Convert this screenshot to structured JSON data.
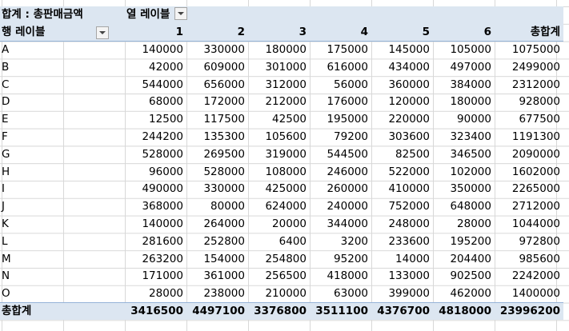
{
  "pivot": {
    "value_header": "합계 : 총판매금액",
    "col_label_header": "열 레이블",
    "row_label_header": "행 레이블",
    "grand_total_label": "총합계",
    "columns": [
      "1",
      "2",
      "3",
      "4",
      "5",
      "6"
    ],
    "rows": [
      {
        "label": "A",
        "values": [
          "140000",
          "330000",
          "180000",
          "175000",
          "145000",
          "105000"
        ],
        "total": "1075000"
      },
      {
        "label": "B",
        "values": [
          "42000",
          "609000",
          "301000",
          "616000",
          "434000",
          "497000"
        ],
        "total": "2499000"
      },
      {
        "label": "C",
        "values": [
          "544000",
          "656000",
          "312000",
          "56000",
          "360000",
          "384000"
        ],
        "total": "2312000"
      },
      {
        "label": "D",
        "values": [
          "68000",
          "172000",
          "212000",
          "176000",
          "120000",
          "180000"
        ],
        "total": "928000"
      },
      {
        "label": "E",
        "values": [
          "12500",
          "117500",
          "42500",
          "195000",
          "220000",
          "90000"
        ],
        "total": "677500"
      },
      {
        "label": "F",
        "values": [
          "244200",
          "135300",
          "105600",
          "79200",
          "303600",
          "323400"
        ],
        "total": "1191300"
      },
      {
        "label": "G",
        "values": [
          "528000",
          "269500",
          "319000",
          "544500",
          "82500",
          "346500"
        ],
        "total": "2090000"
      },
      {
        "label": "H",
        "values": [
          "96000",
          "528000",
          "108000",
          "246000",
          "522000",
          "102000"
        ],
        "total": "1602000"
      },
      {
        "label": "I",
        "values": [
          "490000",
          "330000",
          "425000",
          "260000",
          "410000",
          "350000"
        ],
        "total": "2265000"
      },
      {
        "label": "J",
        "values": [
          "368000",
          "80000",
          "624000",
          "240000",
          "752000",
          "648000"
        ],
        "total": "2712000"
      },
      {
        "label": "K",
        "values": [
          "140000",
          "264000",
          "20000",
          "344000",
          "248000",
          "28000"
        ],
        "total": "1044000"
      },
      {
        "label": "L",
        "values": [
          "281600",
          "252800",
          "6400",
          "3200",
          "233600",
          "195200"
        ],
        "total": "972800"
      },
      {
        "label": "M",
        "values": [
          "263200",
          "154000",
          "254800",
          "95200",
          "14000",
          "204400"
        ],
        "total": "985600"
      },
      {
        "label": "N",
        "values": [
          "171000",
          "361000",
          "256500",
          "418000",
          "133000",
          "902500"
        ],
        "total": "2242000"
      },
      {
        "label": "O",
        "values": [
          "28000",
          "238000",
          "210000",
          "63000",
          "399000",
          "462000"
        ],
        "total": "1400000"
      }
    ],
    "grand_totals": [
      "3416500",
      "4497100",
      "3376800",
      "3511100",
      "4376700",
      "4818000"
    ],
    "grand_total_all": "23996200"
  },
  "colors": {
    "header_fill": "#dce6f1",
    "header_border": "#95b3d7",
    "gridline": "#d8d8d8"
  }
}
